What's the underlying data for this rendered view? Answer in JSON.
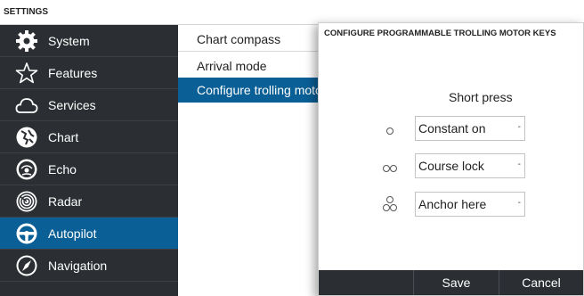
{
  "settings": {
    "title": "SETTINGS",
    "sidebar": [
      {
        "label": "System",
        "icon": "gear-icon"
      },
      {
        "label": "Features",
        "icon": "star-icon"
      },
      {
        "label": "Services",
        "icon": "cloud-icon"
      },
      {
        "label": "Chart",
        "icon": "chart-icon"
      },
      {
        "label": "Echo",
        "icon": "echo-icon"
      },
      {
        "label": "Radar",
        "icon": "radar-icon"
      },
      {
        "label": "Autopilot",
        "icon": "steering-wheel-icon",
        "selected": true
      },
      {
        "label": "Navigation",
        "icon": "compass-icon"
      }
    ],
    "submenu": [
      {
        "label": "Chart compass"
      },
      {
        "label": "Arrival mode"
      },
      {
        "label": "Configure trolling motor k",
        "selected": true
      }
    ]
  },
  "dialog": {
    "title": "CONFIGURE PROGRAMMABLE TROLLING MOTOR KEYS",
    "column_header": "Short press",
    "rows": [
      {
        "press_icon": "single-circle-icon",
        "value": "Constant on"
      },
      {
        "press_icon": "double-circle-icon",
        "value": "Course lock"
      },
      {
        "press_icon": "triple-circle-icon",
        "value": "Anchor here"
      }
    ],
    "dropdown_arrow": "-",
    "buttons": {
      "save": "Save",
      "cancel": "Cancel"
    }
  },
  "colors": {
    "sidebar_bg": "#2b2f33",
    "selected_bg": "#0a5f96",
    "footer_bg": "#2b2f33"
  }
}
